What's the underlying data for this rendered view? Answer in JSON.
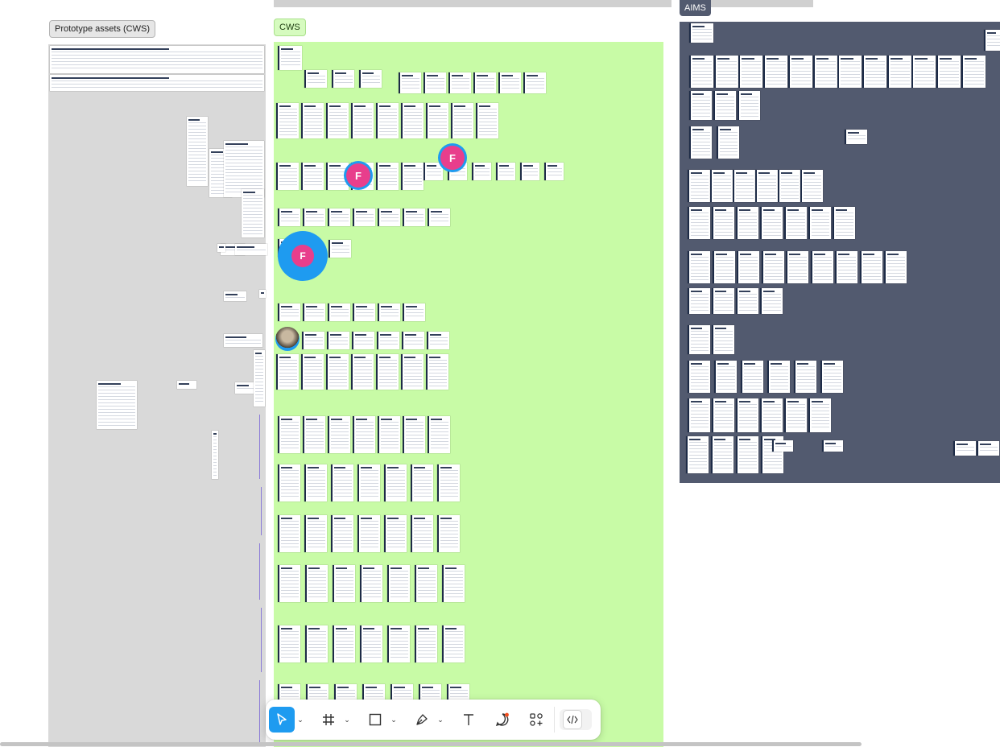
{
  "canvas": {
    "sections": [
      {
        "label": "Prototype assets (CWS)",
        "color": "#d9d9d9"
      },
      {
        "label": "CWS",
        "color": "#c8fba6"
      },
      {
        "label": "AIMS",
        "color": "#525a6f"
      }
    ],
    "collaborators": [
      {
        "initial": "F",
        "color": "#e83e8c"
      },
      {
        "initial": "F",
        "color": "#e83e8c"
      },
      {
        "initial": "F",
        "color": "#e83e8c"
      }
    ]
  },
  "toolbar": {
    "tools": [
      {
        "name": "move-tool",
        "icon": "pointer-icon",
        "active": true,
        "has_menu": true
      },
      {
        "name": "frame-tool",
        "icon": "frame-hash-icon",
        "active": false,
        "has_menu": true
      },
      {
        "name": "shape-tool",
        "icon": "rectangle-icon",
        "active": false,
        "has_menu": true
      },
      {
        "name": "pen-tool",
        "icon": "pen-icon",
        "active": false,
        "has_menu": true
      },
      {
        "name": "text-tool",
        "icon": "text-T-icon",
        "active": false,
        "has_menu": false
      },
      {
        "name": "comment-tool",
        "icon": "comment-bubble-icon",
        "active": false,
        "has_menu": false
      },
      {
        "name": "actions-tool",
        "icon": "shapes-plus-icon",
        "active": false,
        "has_menu": false
      }
    ],
    "dev_mode": {
      "icon": "code-brackets-icon",
      "enabled": false
    },
    "accent_color": "#1e9bf0"
  }
}
